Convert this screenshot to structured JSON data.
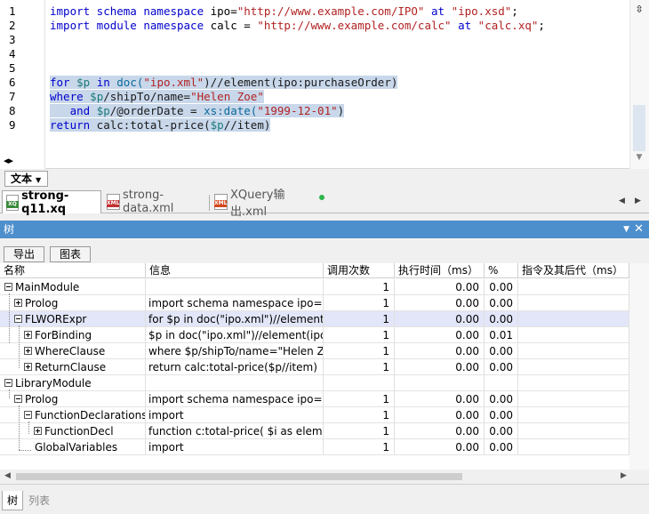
{
  "editor": {
    "line_numbers": [
      "1",
      "2",
      "3",
      "4",
      "5",
      "6",
      "7",
      "8",
      "9"
    ],
    "lines": [
      [
        {
          "t": "import",
          "c": "kw"
        },
        {
          "t": " schema namespace ",
          "c": "kw"
        },
        {
          "t": "ipo",
          "c": "plain"
        },
        {
          "t": "=",
          "c": "plain"
        },
        {
          "t": "\"http://www.example.com/IPO\"",
          "c": "str"
        },
        {
          "t": " at ",
          "c": "kw"
        },
        {
          "t": "\"ipo.xsd\"",
          "c": "str"
        },
        {
          "t": ";",
          "c": "plain"
        }
      ],
      [
        {
          "t": "import",
          "c": "kw"
        },
        {
          "t": " module namespace ",
          "c": "kw"
        },
        {
          "t": "calc",
          "c": "plain"
        },
        {
          "t": " = ",
          "c": "plain"
        },
        {
          "t": "\"http://www.example.com/calc\"",
          "c": "str"
        },
        {
          "t": " at ",
          "c": "kw"
        },
        {
          "t": "\"calc.xq\"",
          "c": "str"
        },
        {
          "t": ";",
          "c": "plain"
        }
      ],
      [],
      [],
      [],
      [
        {
          "t": "for",
          "c": "kw"
        },
        {
          "t": " ",
          "c": "plain"
        },
        {
          "t": "$p",
          "c": "var"
        },
        {
          "t": " in ",
          "c": "kw"
        },
        {
          "t": "doc(",
          "c": "fn"
        },
        {
          "t": "\"ipo.xml\"",
          "c": "str"
        },
        {
          "t": ")//element(ipo:purchaseOrder)",
          "c": "el"
        }
      ],
      [
        {
          "t": "where",
          "c": "kw"
        },
        {
          "t": " ",
          "c": "plain"
        },
        {
          "t": "$p",
          "c": "var"
        },
        {
          "t": "/shipTo/name=",
          "c": "el"
        },
        {
          "t": "\"Helen Zoe\"",
          "c": "str"
        }
      ],
      [
        {
          "t": "   and ",
          "c": "kw"
        },
        {
          "t": "$p",
          "c": "var"
        },
        {
          "t": "/@orderDate = ",
          "c": "el"
        },
        {
          "t": "xs:date(",
          "c": "fn"
        },
        {
          "t": "\"1999-12-01\"",
          "c": "str"
        },
        {
          "t": ")",
          "c": "el"
        }
      ],
      [
        {
          "t": "return",
          "c": "kw"
        },
        {
          "t": " calc:total-price(",
          "c": "el"
        },
        {
          "t": "$p",
          "c": "var"
        },
        {
          "t": "//item)",
          "c": "el"
        }
      ]
    ]
  },
  "modebar": {
    "label": "文本"
  },
  "tabs": [
    {
      "label": "strong-q11.xq",
      "badge": "XQ",
      "active": true
    },
    {
      "label": "strong-data.xml",
      "badge": "XML",
      "active": false
    },
    {
      "label": "XQuery输出.xml",
      "badge": "XML",
      "active": false
    }
  ],
  "panel": {
    "title": "树"
  },
  "toolbar": {
    "export_label": "导出",
    "chart_label": "图表"
  },
  "columns": [
    "名称",
    "信息",
    "调用次数",
    "执行时间（ms）",
    "%",
    "指令及其后代（ms）"
  ],
  "rows": [
    {
      "name": "MainModule",
      "info": "",
      "calls": "1",
      "time": "0.00",
      "pct": "0.00",
      "level": 0,
      "expander": "minus",
      "highlight": false
    },
    {
      "name": "Prolog",
      "info": "import schema namespace ipo=\"h...",
      "calls": "1",
      "time": "0.00",
      "pct": "0.00",
      "level": 1,
      "expander": "plus",
      "highlight": false
    },
    {
      "name": "FLWORExpr",
      "info": "for $p in doc(\"ipo.xml\")//element(i...",
      "calls": "1",
      "time": "0.00",
      "pct": "0.00",
      "level": 1,
      "expander": "minus",
      "highlight": true
    },
    {
      "name": "ForBinding",
      "info": "$p in doc(\"ipo.xml\")//element(ipo:...",
      "calls": "1",
      "time": "0.00",
      "pct": "0.01",
      "level": 2,
      "expander": "plus",
      "highlight": false
    },
    {
      "name": "WhereClause",
      "info": "where $p/shipTo/name=\"Helen Zo...",
      "calls": "1",
      "time": "0.00",
      "pct": "0.00",
      "level": 2,
      "expander": "plus",
      "highlight": false
    },
    {
      "name": "ReturnClause",
      "info": "return calc:total-price($p//item)",
      "calls": "1",
      "time": "0.00",
      "pct": "0.00",
      "level": 2,
      "expander": "plus",
      "highlight": false
    },
    {
      "name": "LibraryModule",
      "info": "",
      "calls": "",
      "time": "",
      "pct": "",
      "level": 0,
      "expander": "minus",
      "highlight": false
    },
    {
      "name": "Prolog",
      "info": "import schema namespace ipo=\"h...",
      "calls": "1",
      "time": "0.00",
      "pct": "0.00",
      "level": 1,
      "expander": "minus",
      "highlight": false
    },
    {
      "name": "FunctionDeclarations",
      "info": "import",
      "calls": "1",
      "time": "0.00",
      "pct": "0.00",
      "level": 2,
      "expander": "minus",
      "highlight": false
    },
    {
      "name": "FunctionDecl",
      "info": "function c:total-price( $i as elemen...",
      "calls": "1",
      "time": "0.00",
      "pct": "0.00",
      "level": 3,
      "expander": "plus",
      "highlight": false
    },
    {
      "name": "GlobalVariables",
      "info": "import",
      "calls": "1",
      "time": "0.00",
      "pct": "0.00",
      "level": 2,
      "expander": "none",
      "highlight": false
    }
  ],
  "bottom_tabs": [
    {
      "label": "树",
      "active": true
    },
    {
      "label": "列表",
      "active": false
    }
  ]
}
